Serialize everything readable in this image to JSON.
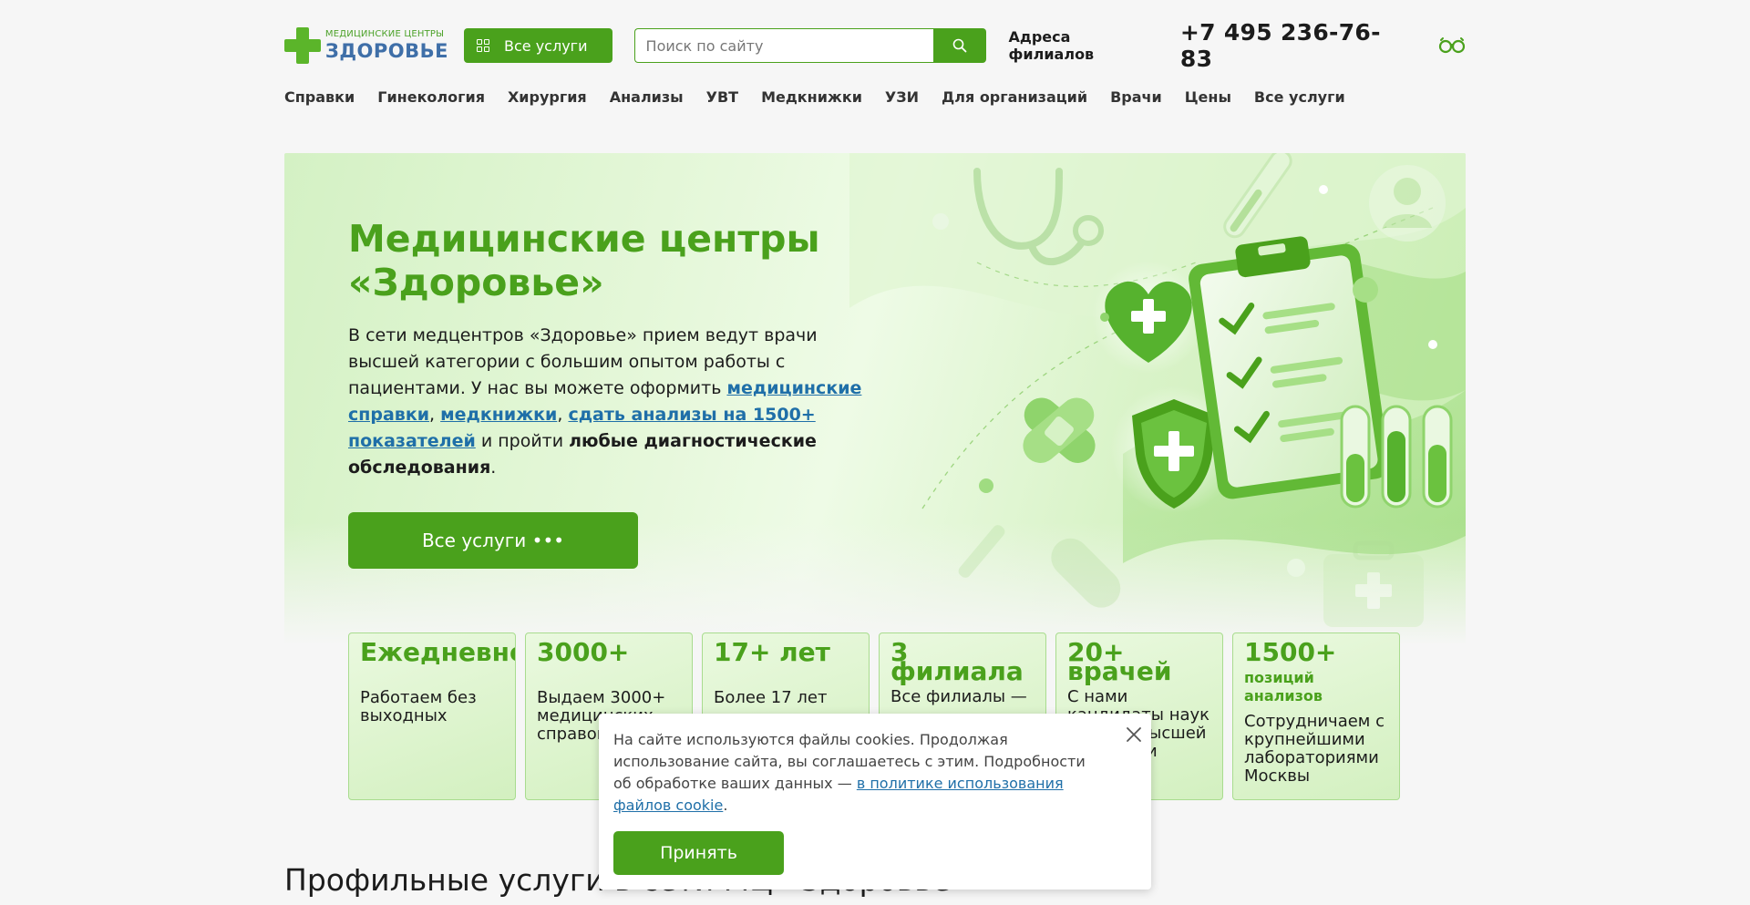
{
  "header": {
    "logo_small": "МЕДИЦИНСКИЕ ЦЕНТРЫ",
    "logo_big": "ЗДОРОВЬЕ",
    "all_services_label": "Все услуги",
    "search_placeholder": "Поиск по сайту",
    "addresses_label": "Адреса филиалов",
    "phone": "+7 495 236-76-83"
  },
  "nav": {
    "items": [
      "Справки",
      "Гинекология",
      "Хирургия",
      "Анализы",
      "УВТ",
      "Медкнижки",
      "УЗИ",
      "Для организаций",
      "Врачи",
      "Цены",
      "Все услуги"
    ]
  },
  "hero": {
    "title_line1": "Медицинские центры",
    "title_line2": "«Здоровье»",
    "text_1": "В сети медцентров «Здоровье» прием ведут врачи высшей категории с большим опытом работы с пациентами. У нас вы можете оформить ",
    "link_1": "медицинские справки",
    "sep_1": ", ",
    "link_2": "медкнижки",
    "sep_2": ", ",
    "link_3": "сдать анализы на 1500+ показателей",
    "text_2": " и пройти ",
    "bold_1": "любые диагностические обследования",
    "text_3": ".",
    "button_label": "Все услуги •••"
  },
  "stats": [
    {
      "title": "Ежедневно",
      "desc": "Работаем без выходных"
    },
    {
      "title": "3000+",
      "desc": "Выдаем 3000+ медицинских справок"
    },
    {
      "title": "17+ лет",
      "desc": "Более 17 лет"
    },
    {
      "title": "3 филиала",
      "desc": "Все филиалы —"
    },
    {
      "title": "20+ врачей",
      "desc": "С нами кандидаты наук и врачи высшей категории"
    },
    {
      "title": "1500+",
      "sub": "позиций анализов",
      "desc": "Сотрудничаем с крупнейшими лабораториями Москвы"
    }
  ],
  "section": {
    "title": "Профильные услуги в сети МЦ «Здоровье»"
  },
  "cookie": {
    "text": "На сайте используются файлы cookies. Продолжая использование сайта, вы соглашаетесь с этим. Подробности об обработке ваших данных — ",
    "link": "в политике использования файлов cookie",
    "end": ".",
    "accept_label": "Принять"
  },
  "colors": {
    "accent": "#4aa11c",
    "link": "#1f6fa8",
    "logo_blue": "#3f6fa8"
  },
  "icons": [
    "grid-icon",
    "search-icon",
    "glasses-icon",
    "close-icon",
    "medical-cross-icon"
  ]
}
